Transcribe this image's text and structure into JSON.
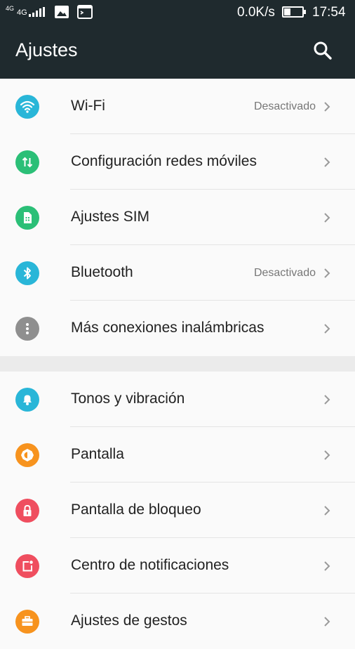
{
  "status_bar": {
    "network_top": "4G",
    "network_label": "4G",
    "speed": "0.0K/s",
    "time": "17:54"
  },
  "app_bar": {
    "title": "Ajustes",
    "search_icon": "search-icon"
  },
  "groups": [
    {
      "items": [
        {
          "label": "Wi-Fi",
          "status": "Desactivado",
          "icon": "wifi-icon",
          "color": "#29b6d8"
        },
        {
          "label": "Configuración redes móviles",
          "status": "",
          "icon": "mobile-data-icon",
          "color": "#2bbf77"
        },
        {
          "label": "Ajustes SIM",
          "status": "",
          "icon": "sim-icon",
          "color": "#2bbf77"
        },
        {
          "label": "Bluetooth",
          "status": "Desactivado",
          "icon": "bluetooth-icon",
          "color": "#29b6d8"
        },
        {
          "label": "Más conexiones inalámbricas",
          "status": "",
          "icon": "more-icon",
          "color": "#8f8f8f"
        }
      ]
    },
    {
      "items": [
        {
          "label": "Tonos y vibración",
          "status": "",
          "icon": "bell-icon",
          "color": "#29b6d8"
        },
        {
          "label": "Pantalla",
          "status": "",
          "icon": "brightness-icon",
          "color": "#f7931e"
        },
        {
          "label": "Pantalla de bloqueo",
          "status": "",
          "icon": "lock-icon",
          "color": "#ef4e5f"
        },
        {
          "label": "Centro de notificaciones",
          "status": "",
          "icon": "notification-icon",
          "color": "#ef4e5f"
        },
        {
          "label": "Ajustes de gestos",
          "status": "",
          "icon": "briefcase-icon",
          "color": "#f7931e"
        }
      ]
    }
  ]
}
